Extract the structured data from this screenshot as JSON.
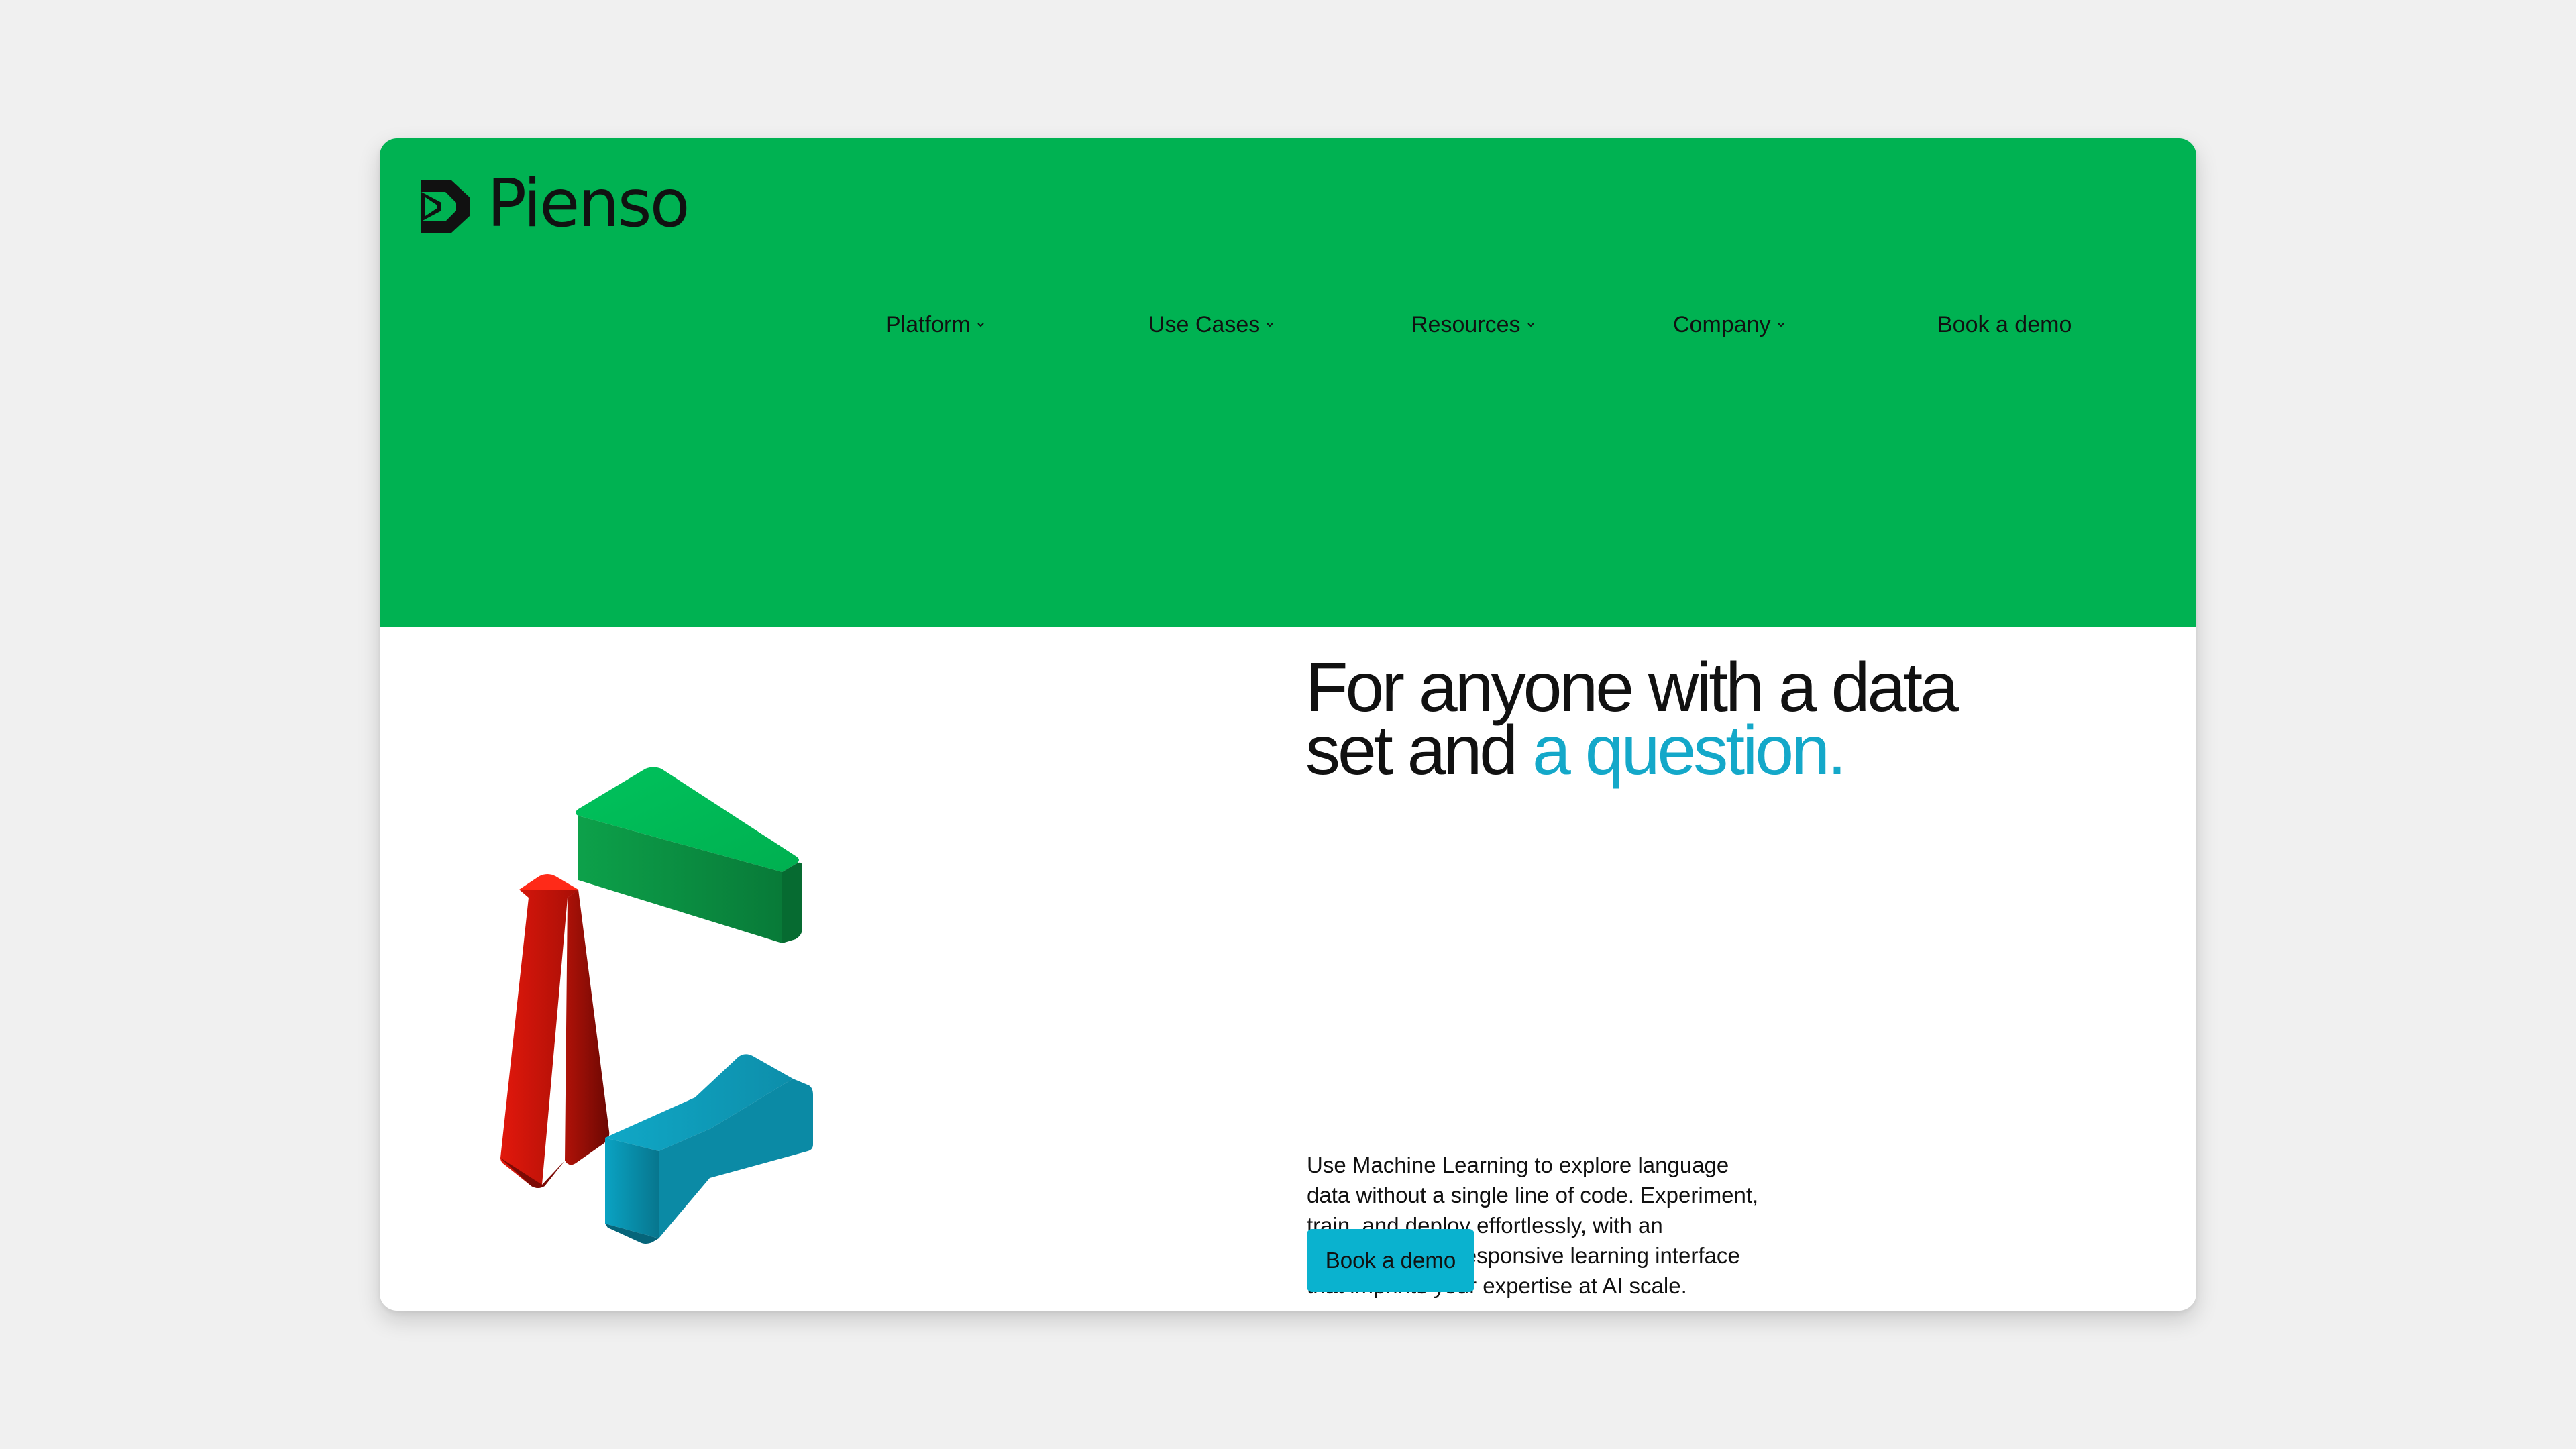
{
  "brand": {
    "name": "Pienso",
    "logo_icon": "pienso-logo-mark-icon",
    "colors": {
      "primary_green": "#00b252",
      "accent_blue": "#0ab2cf",
      "red": "#e0180a"
    }
  },
  "nav": {
    "items": [
      {
        "label": "Platform",
        "icon": "chevron-down-icon"
      },
      {
        "label": "Use Cases",
        "icon": "chevron-down-icon"
      },
      {
        "label": "Resources",
        "icon": "chevron-down-icon"
      },
      {
        "label": "Company",
        "icon": "chevron-down-icon"
      }
    ],
    "cta_label": "Book a demo"
  },
  "hero": {
    "headline_line1": "For anyone with a data",
    "headline_line2_plain": "set and ",
    "headline_line2_accent": "a question.",
    "description": "Use Machine Learning to explore language data without a single line of code. Experiment, train, and deploy effortlessly, with an interactive and responsive learning interface that imprints your expertise at AI scale.",
    "cta_label": "Book a demo",
    "illustration_icon": "3d-play-triangle-blocks-icon"
  }
}
